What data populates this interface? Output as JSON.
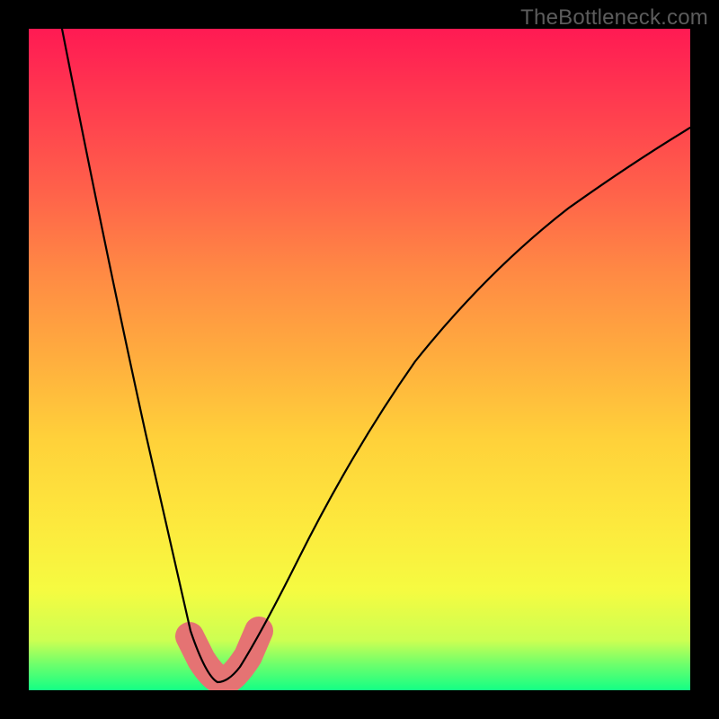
{
  "watermark": "TheBottleneck.com",
  "colors": {
    "frame": "#000000",
    "curve": "#000000",
    "marker": "#e57373",
    "gradient_top": "#ff1a53",
    "gradient_bottom": "#14ff85"
  },
  "chart_data": {
    "type": "line",
    "title": "",
    "xlabel": "",
    "ylabel": "",
    "xlim": [
      0,
      100
    ],
    "ylim": [
      0,
      100
    ],
    "grid": false,
    "legend": false,
    "note": "No axis ticks or numeric labels are visible; values are estimated from curve geometry in plot-area percent coordinates (0,0 bottom-left → 100,100 top-right).",
    "series": [
      {
        "name": "bottleneck-curve",
        "x": [
          5,
          10,
          15,
          20,
          23,
          25,
          27,
          28,
          29.5,
          31,
          33,
          35,
          40,
          45,
          50,
          55,
          60,
          70,
          80,
          90,
          100
        ],
        "y": [
          100,
          78,
          55,
          28,
          11,
          5,
          2,
          1.5,
          1.2,
          1.5,
          2.5,
          6,
          16,
          27,
          37,
          46,
          54,
          66,
          75,
          81,
          85
        ]
      }
    ],
    "markers": [
      {
        "name": "optimal-range",
        "shape": "v-band",
        "x": [
          25,
          27,
          28,
          29.5,
          31,
          33,
          35
        ],
        "y": [
          6,
          2.5,
          1.7,
          1.3,
          1.7,
          3,
          6.5
        ]
      }
    ],
    "background_meaning": "vertical red→green gradient indicating bad (top) → good (bottom) bottleneck score"
  }
}
